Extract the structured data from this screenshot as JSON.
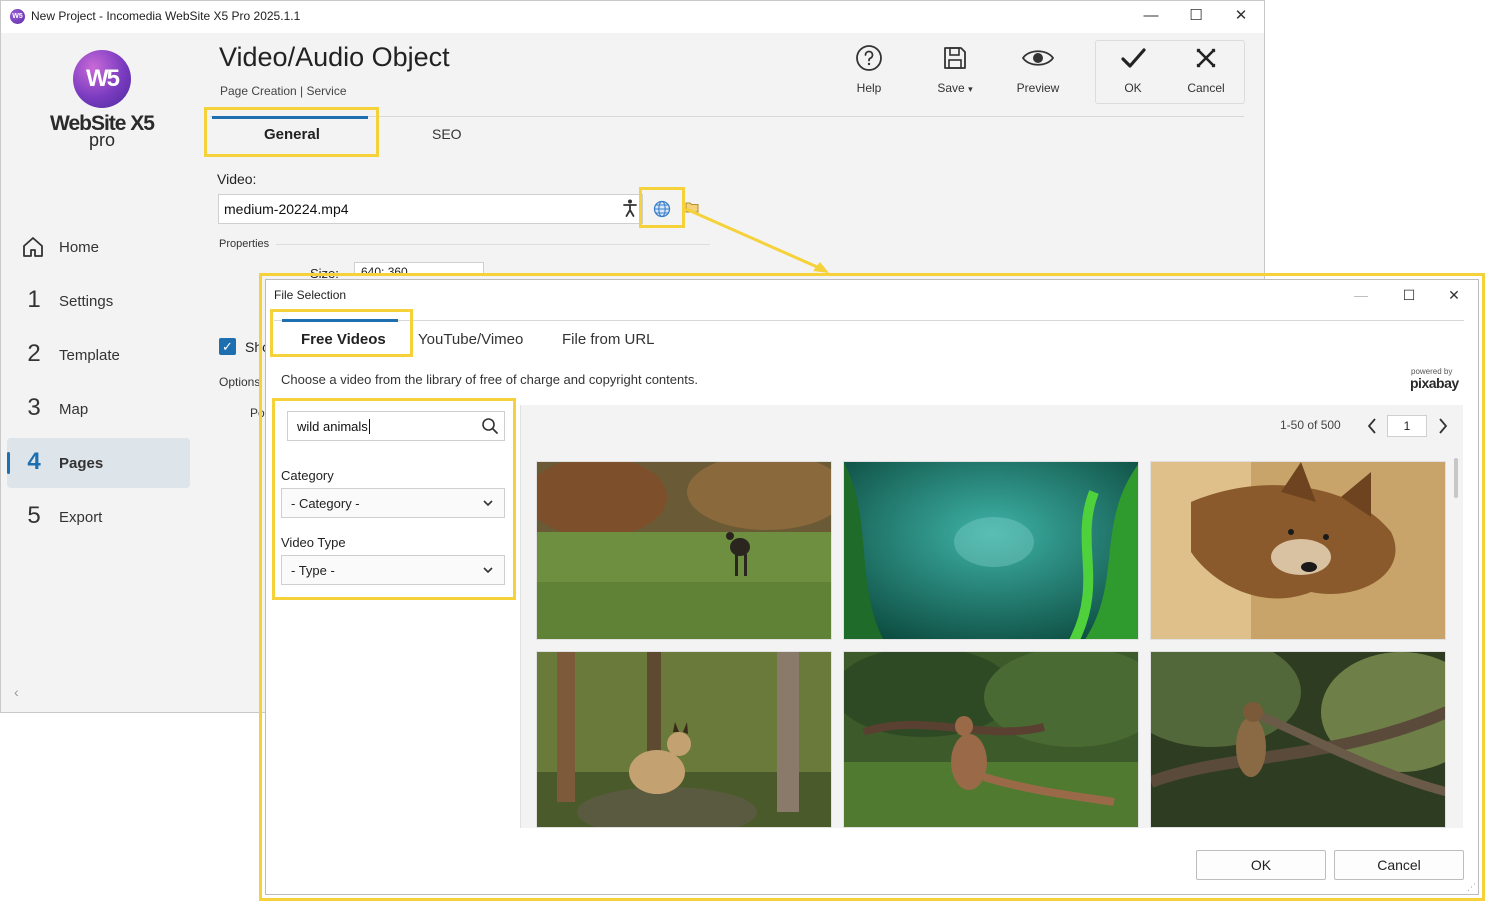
{
  "window": {
    "title": "New Project - Incomedia WebSite X5 Pro 2025.1.1",
    "controls": {
      "minimize": "—",
      "maximize": "☐",
      "close": "✕"
    }
  },
  "logo": {
    "mark": "W5",
    "name": "WebSite X5",
    "edition": "pro"
  },
  "nav": {
    "items": [
      {
        "num": "",
        "label": "Home",
        "icon": "home-icon"
      },
      {
        "num": "1",
        "label": "Settings"
      },
      {
        "num": "2",
        "label": "Template"
      },
      {
        "num": "3",
        "label": "Map"
      },
      {
        "num": "4",
        "label": "Pages",
        "active": true
      },
      {
        "num": "5",
        "label": "Export"
      }
    ],
    "collapse": "‹"
  },
  "header": {
    "title": "Video/Audio Object",
    "breadcrumb": "Page Creation | Service"
  },
  "toolbar": {
    "help": "Help",
    "save": "Save",
    "save_arrow": "▾",
    "preview": "Preview",
    "ok": "OK",
    "cancel": "Cancel"
  },
  "tabs": {
    "general": "General",
    "seo": "SEO"
  },
  "form": {
    "video_label": "Video:",
    "video_value": "medium-20224.mp4",
    "properties_label": "Properties",
    "size_label": "Size:",
    "size_value": "640; 360",
    "show_label": "Sho",
    "options_label": "Options",
    "po_label": "Po"
  },
  "dialog": {
    "title": "File Selection",
    "controls": {
      "minimize": "—",
      "maximize": "☐",
      "close": "✕"
    },
    "tabs": [
      "Free Videos",
      "YouTube/Vimeo",
      "File from URL"
    ],
    "description": "Choose a video from the library of free of charge and copyright contents.",
    "powered_by": "powered by",
    "provider": "pixabay",
    "search_value": "wild animals",
    "category_label": "Category",
    "category_value": "- Category -",
    "video_type_label": "Video Type",
    "video_type_value": "- Type -",
    "pager_text": "1-50 of 500",
    "page_value": "1",
    "ok": "OK",
    "cancel": "Cancel"
  },
  "colors": {
    "highlight": "#f5d13a",
    "accent": "#1e6fb0"
  }
}
